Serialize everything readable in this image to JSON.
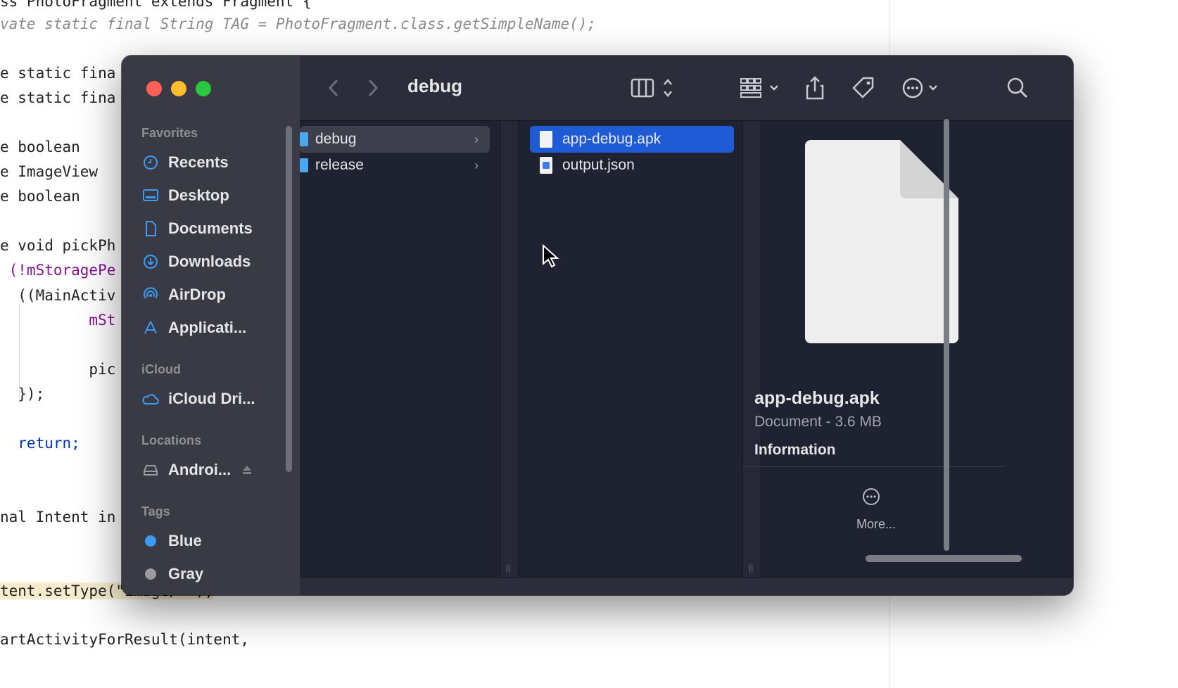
{
  "code": {
    "lines": [
      "ss PhotoFragment extends Fragment {",
      "vate static final String TAG = PhotoFragment.class.getSimpleName();",
      "e static fina",
      "e static fina",
      "e boolean   ",
      "e ImageView ",
      "e boolean   ",
      "e void pickPh",
      " (!mStoragePe",
      "  ((MainActiv",
      "          mSt",
      "          pic",
      "  });",
      "  return;",
      "nal Intent in",
      "tent.setType(\"image/*\");",
      "artActivityForResult(intent,"
    ]
  },
  "window": {
    "current_folder": "debug"
  },
  "sidebar": {
    "sections": {
      "favorites": "Favorites",
      "icloud": "iCloud",
      "locations": "Locations",
      "tags": "Tags"
    },
    "favorites": [
      "Recents",
      "Desktop",
      "Documents",
      "Downloads",
      "AirDrop",
      "Applicati..."
    ],
    "icloud": [
      "iCloud Dri..."
    ],
    "locations": [
      "Androi..."
    ],
    "tags": [
      "Blue",
      "Gray"
    ],
    "tag_colors": [
      "#3b9bf5",
      "#9a9aa0"
    ]
  },
  "columns": {
    "col1": [
      "debug",
      "release"
    ],
    "col2": [
      "app-debug.apk",
      "output.json"
    ]
  },
  "preview": {
    "name": "app-debug.apk",
    "kind": "Document - 3.6 MB",
    "info_label": "Information",
    "more_label": "More..."
  },
  "icons": {
    "back": "chevron-left-icon",
    "forward": "chevron-right-icon",
    "view": "column-view-icon",
    "group": "grid-group-icon",
    "share": "share-icon",
    "tag": "tag-icon",
    "action": "ellipsis-circle-icon",
    "search": "search-icon"
  },
  "colors": {
    "selection": "#1f5bd4",
    "close": "#fe5f57",
    "minimize": "#febc2e",
    "zoom": "#28c840"
  }
}
